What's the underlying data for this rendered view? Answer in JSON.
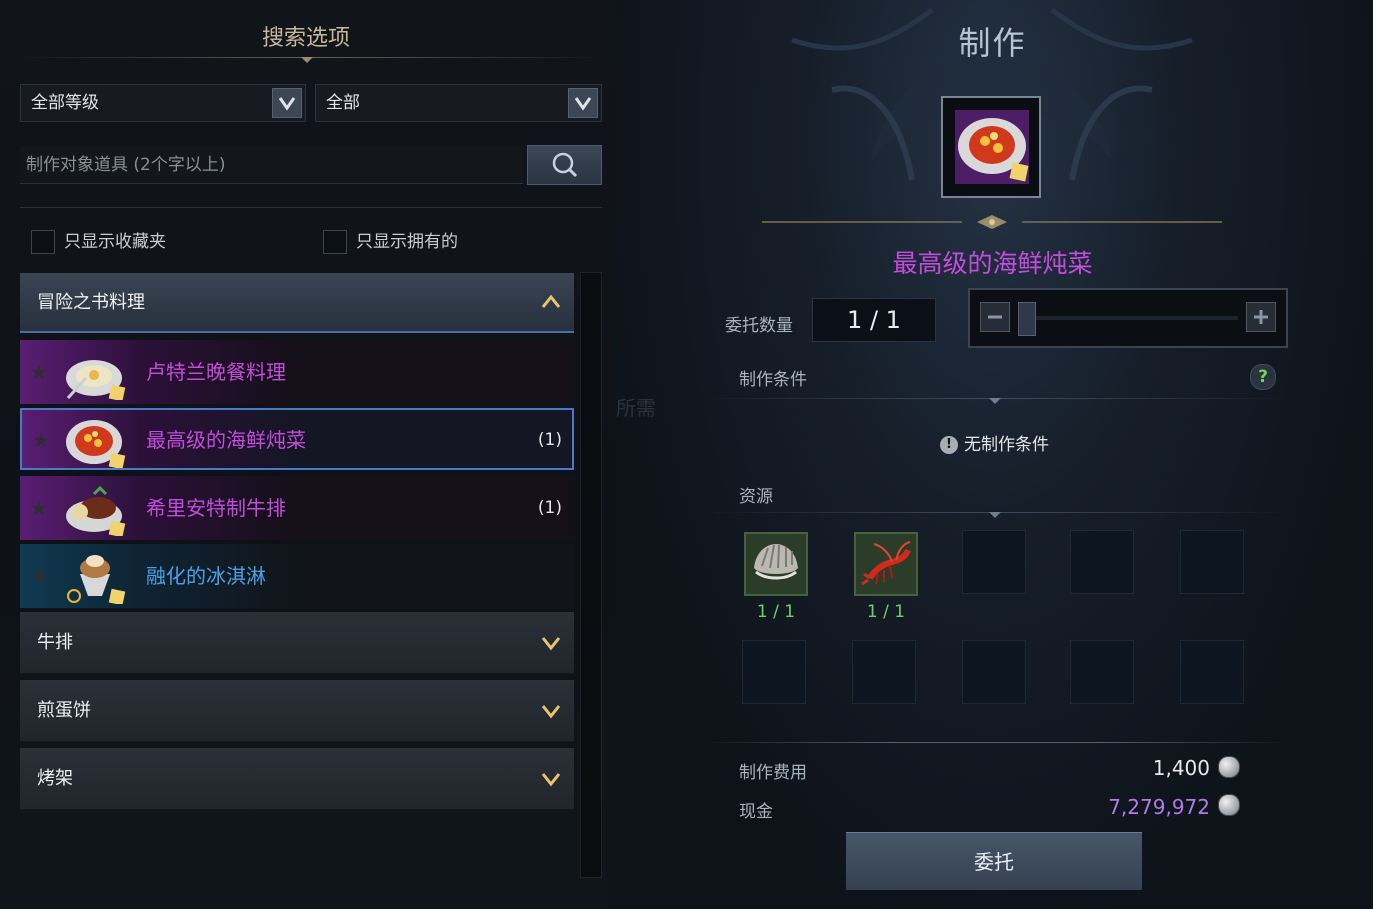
{
  "search_panel": {
    "title": "搜索选项",
    "grade_select": "全部等级",
    "type_select": "全部",
    "search_placeholder": "制作对象道具 (2个字以上)",
    "filter_favorites": "只显示收藏夹",
    "filter_owned": "只显示拥有的"
  },
  "categories": {
    "open": {
      "label": "冒险之书料理",
      "recipes": [
        {
          "name": "卢特兰晚餐料理",
          "count": "",
          "color": "#c24dda"
        },
        {
          "name": "最高级的海鲜炖菜",
          "count": "(1)",
          "color": "#c24dda"
        },
        {
          "name": "希里安特制牛排",
          "count": "(1)",
          "color": "#c24dda"
        },
        {
          "name": "融化的冰淇淋",
          "count": "",
          "color": "#4aa2e6"
        }
      ]
    },
    "collapsed": [
      {
        "label": "牛排"
      },
      {
        "label": "煎蛋饼"
      },
      {
        "label": "烤架"
      }
    ]
  },
  "craft": {
    "title": "制作",
    "item_name": "最高级的海鲜炖菜",
    "item_color": "#c24dda",
    "quantity_label": "委托数量",
    "quantity_value": "1 / 1",
    "quantity_fraction": 1.0,
    "condition_label": "制作条件",
    "help_icon": "?",
    "no_condition": "无制作条件",
    "resources_label": "资源",
    "resources": [
      {
        "icon": "clam-shell-icon",
        "qty": "1 / 1"
      },
      {
        "icon": "red-crayfish-icon",
        "qty": "1 / 1"
      }
    ],
    "cost_label": "制作费用",
    "cost_value": "1,400",
    "cash_label": "现金",
    "cash_value": "7,279,972",
    "cash_color": "#b07ae8",
    "commit_button": "委托",
    "faded_text": "所需"
  }
}
